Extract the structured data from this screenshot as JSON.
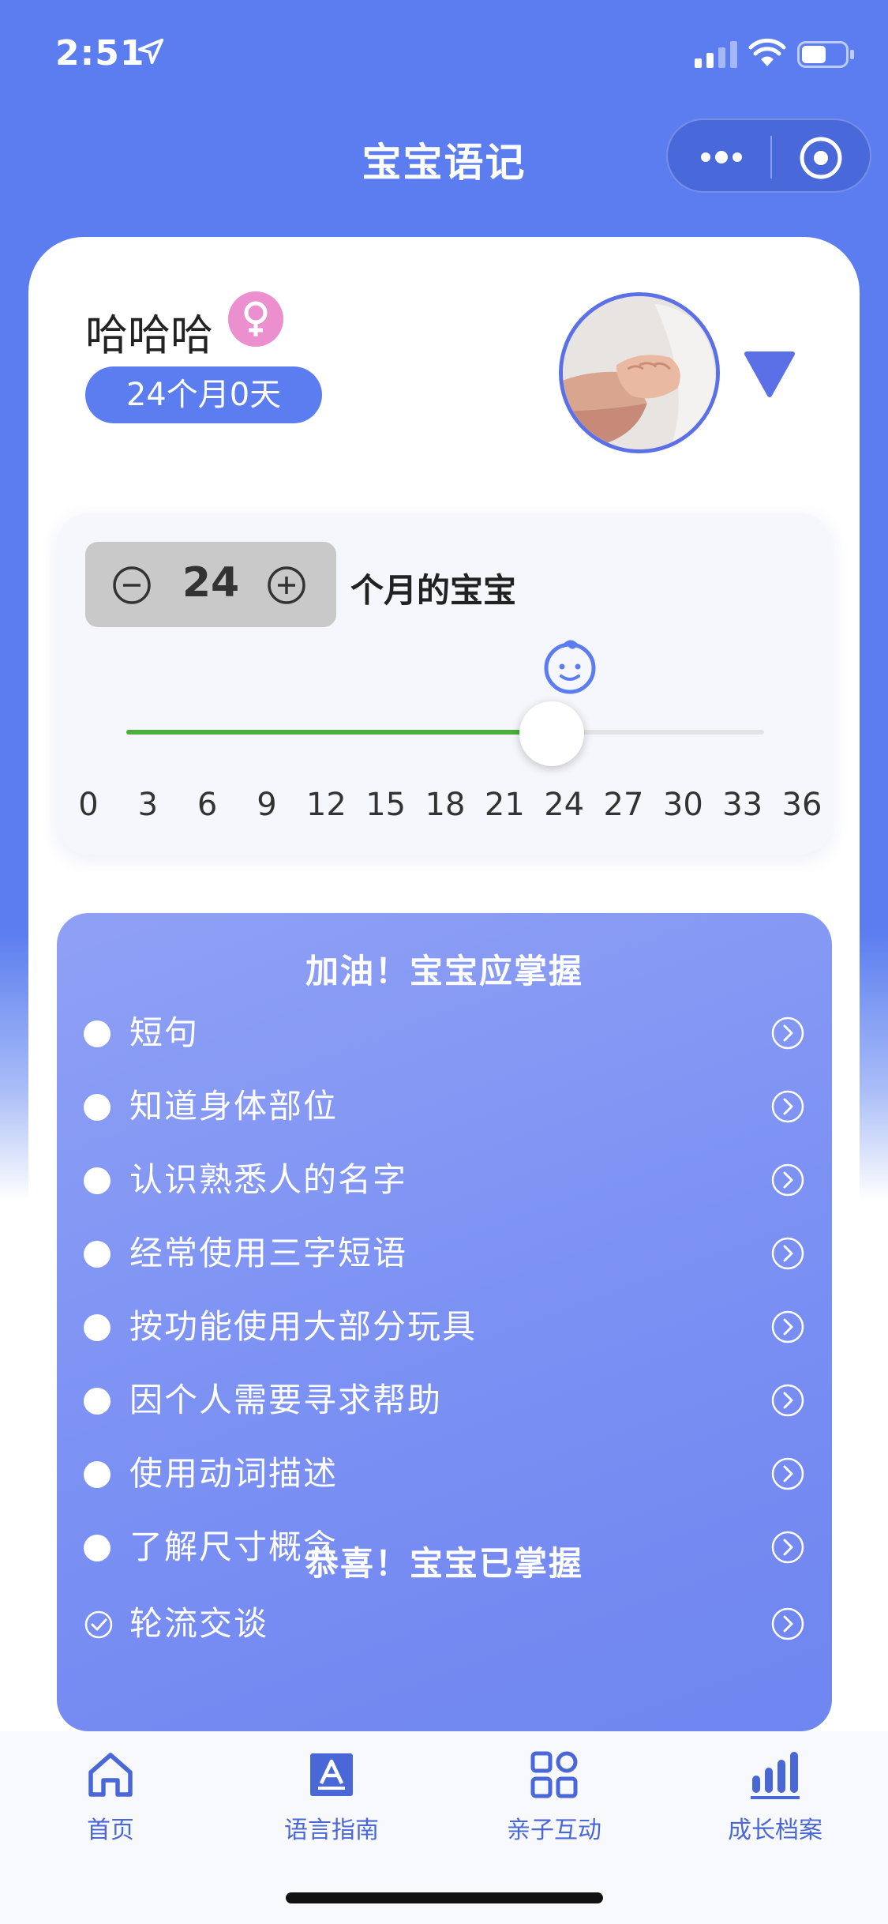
{
  "status_bar": {
    "time": "2:51"
  },
  "nav": {
    "title": "宝宝语记"
  },
  "profile": {
    "name": "哈哈哈",
    "age": "24个月0天"
  },
  "month_selector": {
    "value": "24",
    "suffix": "个月的宝宝",
    "ticks": [
      "0",
      "3",
      "6",
      "9",
      "12",
      "15",
      "18",
      "21",
      "24",
      "27",
      "30",
      "33",
      "36"
    ],
    "min": 0,
    "max": 36,
    "current": 24
  },
  "milestones": {
    "todo_heading": "加油！宝宝应掌握",
    "todo": [
      "短句",
      "知道身体部位",
      "认识熟悉人的名字",
      "经常使用三字短语",
      "按功能使用大部分玩具",
      "因个人需要寻求帮助",
      "使用动词描述",
      "了解尺寸概念"
    ],
    "done_heading": "恭喜！宝宝已掌握",
    "done": [
      "轮流交谈"
    ]
  },
  "tabs": [
    {
      "label": "首页",
      "icon": "home-icon"
    },
    {
      "label": "语言指南",
      "icon": "text-a-icon"
    },
    {
      "label": "亲子互动",
      "icon": "grid-icon"
    },
    {
      "label": "成长档案",
      "icon": "bar-chart-icon"
    }
  ],
  "colors": {
    "primary": "#5b7df0",
    "slider_fill": "#4cae3c",
    "gender": "#ec8fcf"
  }
}
